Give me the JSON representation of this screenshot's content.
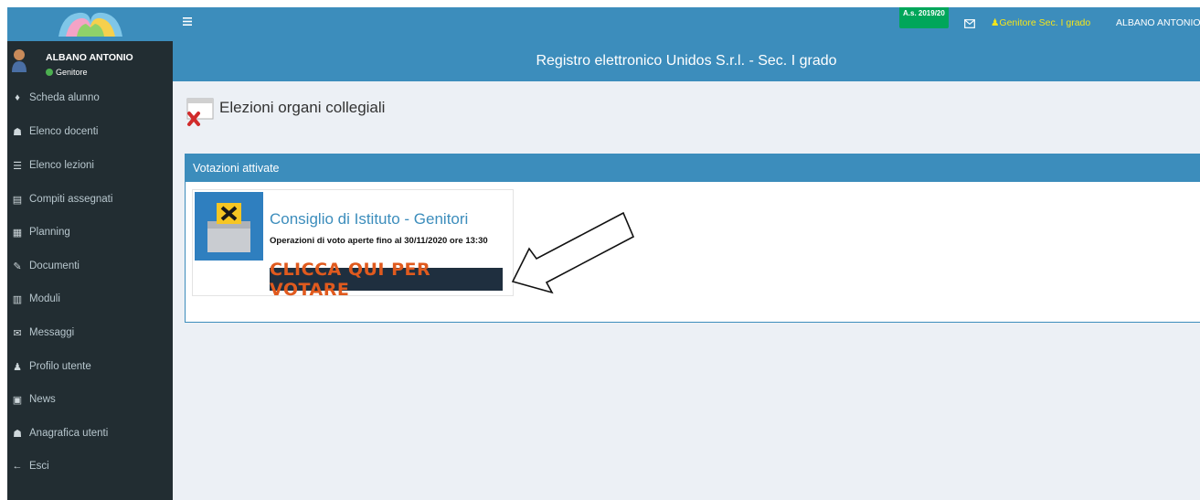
{
  "sidebar": {
    "user_name": "ALBANO ANTONIO",
    "user_role": "Genitore",
    "items": [
      {
        "label": "Scheda alunno",
        "icon": "user-icon"
      },
      {
        "label": "Elenco docenti",
        "icon": "users-icon"
      },
      {
        "label": "Elenco lezioni",
        "icon": "list-icon"
      },
      {
        "label": "Compiti assegnati",
        "icon": "document-icon"
      },
      {
        "label": "Planning",
        "icon": "calendar-icon"
      },
      {
        "label": "Documenti",
        "icon": "paperclip-icon"
      },
      {
        "label": "Moduli",
        "icon": "form-icon"
      },
      {
        "label": "Messaggi",
        "icon": "envelope-icon"
      },
      {
        "label": "Profilo utente",
        "icon": "user-icon"
      },
      {
        "label": "News",
        "icon": "newspaper-icon"
      },
      {
        "label": "Anagrafica utenti",
        "icon": "users-icon"
      },
      {
        "label": "Esci",
        "icon": "arrow-left-icon"
      }
    ]
  },
  "topbar": {
    "school_year": "A.s. 2019/20",
    "role": "Genitore Sec. I grado",
    "user": "ALBANO ANTONIO"
  },
  "header": {
    "title": "Registro elettronico Unidos S.r.l. - Sec. I grado"
  },
  "page": {
    "title": "Elezioni organi collegiali"
  },
  "box": {
    "title": "Votazioni attivate",
    "card": {
      "title": "Consiglio di Istituto - Genitori",
      "description": "Operazioni di voto aperte fino al 30/11/2020 ore 13:30",
      "button": "CLICCA QUI PER VOTARE"
    }
  },
  "colors": {
    "primary": "#3c8dbc",
    "sidebar_bg": "#222d32",
    "vote_button_text": "#e05a1e",
    "year_badge": "#00a65a"
  }
}
